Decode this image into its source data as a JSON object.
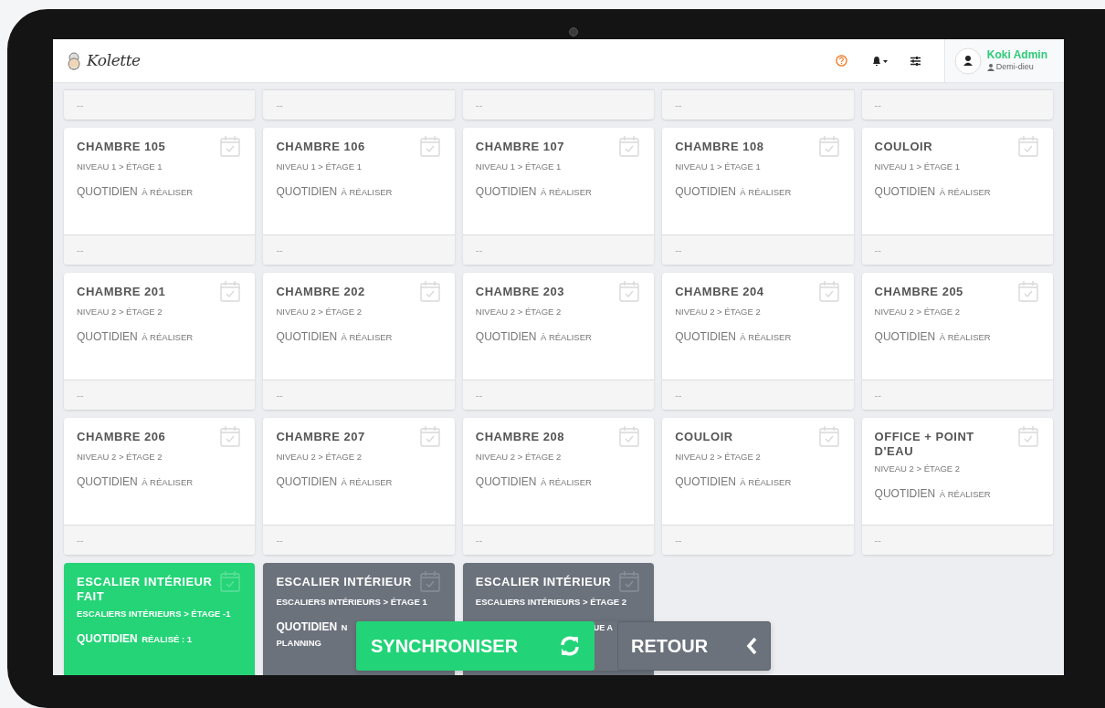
{
  "header": {
    "logo": "Kolette",
    "user": {
      "name": "Koki Admin",
      "role": "Demi-dieu"
    }
  },
  "top_row": [
    {
      "footer": "--"
    },
    {
      "footer": "--"
    },
    {
      "footer": "--"
    },
    {
      "footer": "--"
    },
    {
      "footer": "--"
    }
  ],
  "cards": [
    {
      "kind": "pending",
      "title": "CHAMBRE 105",
      "location": "NIVEAU 1 > ÉTAGE 1",
      "status": "QUOTIDIEN",
      "status_detail": "À RÉALISER",
      "footer": "--"
    },
    {
      "kind": "pending",
      "title": "CHAMBRE 106",
      "location": "NIVEAU 1 > ÉTAGE 1",
      "status": "QUOTIDIEN",
      "status_detail": "À RÉALISER",
      "footer": "--"
    },
    {
      "kind": "pending",
      "title": "CHAMBRE 107",
      "location": "NIVEAU 1 > ÉTAGE 1",
      "status": "QUOTIDIEN",
      "status_detail": "À RÉALISER",
      "footer": "--"
    },
    {
      "kind": "pending",
      "title": "CHAMBRE 108",
      "location": "NIVEAU 1 > ÉTAGE 1",
      "status": "QUOTIDIEN",
      "status_detail": "À RÉALISER",
      "footer": "--"
    },
    {
      "kind": "pending",
      "title": "COULOIR",
      "location": "NIVEAU 1 > ÉTAGE 1",
      "status": "QUOTIDIEN",
      "status_detail": "À RÉALISER",
      "footer": "--"
    },
    {
      "kind": "pending",
      "title": "CHAMBRE 201",
      "location": "NIVEAU 2 > ÉTAGE 2",
      "status": "QUOTIDIEN",
      "status_detail": "À RÉALISER",
      "footer": "--"
    },
    {
      "kind": "pending",
      "title": "CHAMBRE 202",
      "location": "NIVEAU 2 > ÉTAGE 2",
      "status": "QUOTIDIEN",
      "status_detail": "À RÉALISER",
      "footer": "--"
    },
    {
      "kind": "pending",
      "title": "CHAMBRE 203",
      "location": "NIVEAU 2 > ÉTAGE 2",
      "status": "QUOTIDIEN",
      "status_detail": "À RÉALISER",
      "footer": "--"
    },
    {
      "kind": "pending",
      "title": "CHAMBRE 204",
      "location": "NIVEAU 2 > ÉTAGE 2",
      "status": "QUOTIDIEN",
      "status_detail": "À RÉALISER",
      "footer": "--"
    },
    {
      "kind": "pending",
      "title": "CHAMBRE 205",
      "location": "NIVEAU 2 > ÉTAGE 2",
      "status": "QUOTIDIEN",
      "status_detail": "À RÉALISER",
      "footer": "--"
    },
    {
      "kind": "pending",
      "title": "CHAMBRE 206",
      "location": "NIVEAU 2 > ÉTAGE 2",
      "status": "QUOTIDIEN",
      "status_detail": "À RÉALISER",
      "footer": "--"
    },
    {
      "kind": "pending",
      "title": "CHAMBRE 207",
      "location": "NIVEAU 2 > ÉTAGE 2",
      "status": "QUOTIDIEN",
      "status_detail": "À RÉALISER",
      "footer": "--"
    },
    {
      "kind": "pending",
      "title": "CHAMBRE 208",
      "location": "NIVEAU 2 > ÉTAGE 2",
      "status": "QUOTIDIEN",
      "status_detail": "À RÉALISER",
      "footer": "--"
    },
    {
      "kind": "pending",
      "title": "COULOIR",
      "location": "NIVEAU 2 > ÉTAGE 2",
      "status": "QUOTIDIEN",
      "status_detail": "À RÉALISER",
      "footer": "--"
    },
    {
      "kind": "pending",
      "title": "OFFICE + POINT D'EAU",
      "location": "NIVEAU 2 > ÉTAGE 2",
      "status": "QUOTIDIEN",
      "status_detail": "À RÉALISER",
      "footer": "--"
    },
    {
      "kind": "done",
      "title": "ESCALIER INTÉRIEUR FAIT",
      "location": "ESCALIERS INTÉRIEURS > ÉTAGE -1",
      "status": "QUOTIDIEN",
      "status_detail": "RÉALISÉ : 1"
    },
    {
      "kind": "unplanned",
      "title": "ESCALIER INTÉRIEUR",
      "location": "ESCALIERS INTÉRIEURS > ÉTAGE 1",
      "status": "QUOTIDIEN",
      "status_detail": "N",
      "status_line_2": "PLANNING"
    },
    {
      "kind": "unplanned",
      "title": "ESCALIER INTÉRIEUR",
      "location": "ESCALIERS INTÉRIEURS > ÉTAGE 2",
      "status_detail": "UE A"
    }
  ],
  "buttons": [
    {
      "kind": "sync",
      "label": "SYNCHRONISER"
    },
    {
      "kind": "back",
      "label": "RETOUR"
    }
  ]
}
